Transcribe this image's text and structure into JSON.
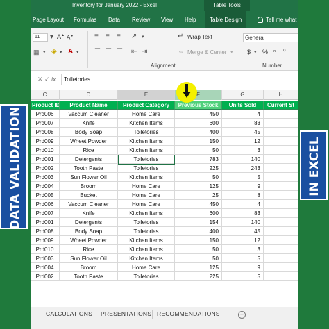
{
  "window": {
    "title": "Inventory for January 2022  -  Excel",
    "context_tab": "Table Tools"
  },
  "ribbon_tabs": [
    "Page Layout",
    "Formulas",
    "Data",
    "Review",
    "View",
    "Help",
    "Table Design",
    "Tell me what"
  ],
  "ribbon": {
    "font_size": "11",
    "wrap_text": "Wrap Text",
    "merge_center": "Merge & Center",
    "number_format": "General",
    "currency_symbol": "$",
    "percent_symbol": "%",
    "alignment_label": "Alignment",
    "number_label": "Number"
  },
  "formula_bar": {
    "value": "Toiletories"
  },
  "columns": [
    "C",
    "D",
    "E",
    "F",
    "G",
    "H"
  ],
  "table": {
    "headers": [
      "Product ID",
      "Product Name",
      "Product Category",
      "Previous Stock",
      "Units Sold",
      "Current St"
    ],
    "rows": [
      [
        "Prd006",
        "Vaccum Cleaner",
        "Home Care",
        "450",
        "4"
      ],
      [
        "Prd007",
        "Knife",
        "Kitchen Items",
        "600",
        "83"
      ],
      [
        "Prd008",
        "Body Soap",
        "Toiletories",
        "400",
        "45"
      ],
      [
        "Prd009",
        "Wheet Powder",
        "Kitchen Items",
        "150",
        "12"
      ],
      [
        "Prd010",
        "Rice",
        "Kitchen Items",
        "50",
        "3"
      ],
      [
        "Prd001",
        "Detergents",
        "Toiletories",
        "783",
        "140"
      ],
      [
        "Prd002",
        "Tooth Paste",
        "Toiletories",
        "225",
        "243"
      ],
      [
        "Prd003",
        "Sun Flower Oil",
        "Kitchen Items",
        "50",
        "5"
      ],
      [
        "Prd004",
        "Broom",
        "Home Care",
        "125",
        "9"
      ],
      [
        "Prd005",
        "Bucket",
        "Home Care",
        "25",
        "8"
      ],
      [
        "Prd006",
        "Vaccum Cleaner",
        "Home Care",
        "450",
        "4"
      ],
      [
        "Prd007",
        "Knife",
        "Kitchen Items",
        "600",
        "83"
      ],
      [
        "Prd001",
        "Detergents",
        "Toiletories",
        "154",
        "140"
      ],
      [
        "Prd008",
        "Body Soap",
        "Toiletories",
        "400",
        "45"
      ],
      [
        "Prd009",
        "Wheet Powder",
        "Kitchen Items",
        "150",
        "12"
      ],
      [
        "Prd010",
        "Rice",
        "Kitchen Items",
        "50",
        "3"
      ],
      [
        "Prd003",
        "Sun Flower Oil",
        "Kitchen Items",
        "50",
        "5"
      ],
      [
        "Prd004",
        "Broom",
        "Home Care",
        "125",
        "9"
      ],
      [
        "Prd002",
        "Tooth Paste",
        "Toiletories",
        "225",
        "5"
      ]
    ]
  },
  "sheet_tabs": [
    "CALCULATIONS",
    "PRESENTATIONS",
    "RECOMMENDATIONS"
  ],
  "overlay": {
    "left_banner": "DATA VALIDATION",
    "right_banner": "IN EXCEL"
  },
  "colors": {
    "excel_green": "#217346",
    "header_green": "#00b050",
    "banner_blue": "#1a4fa0",
    "cursor_yellow": "#f4f000"
  }
}
